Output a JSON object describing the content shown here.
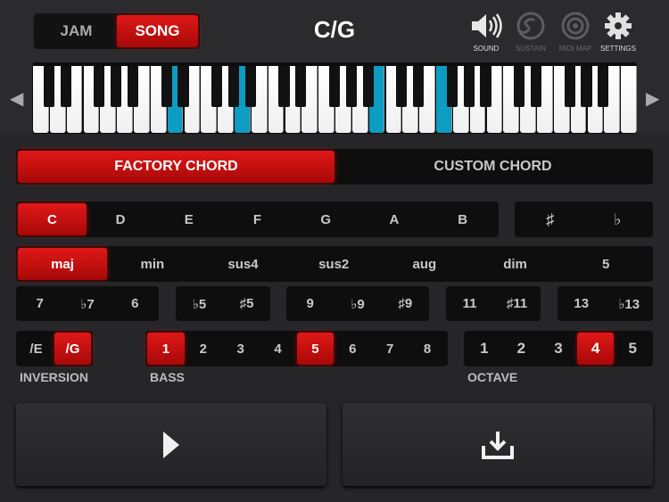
{
  "header": {
    "mode_tabs": [
      {
        "label": "JAM",
        "active": false
      },
      {
        "label": "SONG",
        "active": true
      }
    ],
    "chord_title": "C/G",
    "icons": [
      {
        "label": "SOUND",
        "icon": "speaker-icon",
        "enabled": true
      },
      {
        "label": "SUSTAIN",
        "icon": "sustain-icon",
        "enabled": false
      },
      {
        "label": "MIDI MAP",
        "icon": "midi-map-icon",
        "enabled": false
      },
      {
        "label": "SETTINGS",
        "icon": "gear-icon",
        "enabled": true
      }
    ]
  },
  "keyboard": {
    "highlighted_color": "#0d9cc2",
    "highlighted_white_keys": [
      8,
      12,
      20,
      24
    ],
    "scroll_left_icon": "chevron-left-icon",
    "scroll_right_icon": "chevron-right-icon"
  },
  "chord_source": {
    "tabs": [
      {
        "label": "FACTORY CHORD",
        "active": true
      },
      {
        "label": "CUSTOM CHORD",
        "active": false
      }
    ]
  },
  "roots": {
    "items": [
      "C",
      "D",
      "E",
      "F",
      "G",
      "A",
      "B"
    ],
    "selected": "C"
  },
  "accidentals": {
    "items": [
      "♯",
      "♭"
    ]
  },
  "qualities": {
    "items": [
      "maj",
      "min",
      "sus4",
      "sus2",
      "aug",
      "dim",
      "5"
    ],
    "selected": "maj"
  },
  "extensions": {
    "groups": [
      [
        "7",
        "♭7",
        "6"
      ],
      [
        "♭5",
        "♯5"
      ],
      [
        "9",
        "♭9",
        "♯9"
      ],
      [
        "11",
        "♯11"
      ],
      [
        "13",
        "♭13"
      ]
    ]
  },
  "inversion": {
    "label": "INVERSION",
    "items": [
      "/E",
      "/G"
    ],
    "selected": "/G"
  },
  "bass": {
    "label": "BASS",
    "items": [
      "1",
      "2",
      "3",
      "4",
      "5",
      "6",
      "7",
      "8"
    ],
    "selected": [
      "1",
      "5"
    ]
  },
  "octave": {
    "label": "OCTAVE",
    "items": [
      "1",
      "2",
      "3",
      "4",
      "5"
    ],
    "selected": "4"
  },
  "actions": {
    "play_icon": "play-icon",
    "save_icon": "download-tray-icon"
  },
  "colors": {
    "accent_red": "#d41010",
    "key_highlight": "#0d9cc2"
  }
}
